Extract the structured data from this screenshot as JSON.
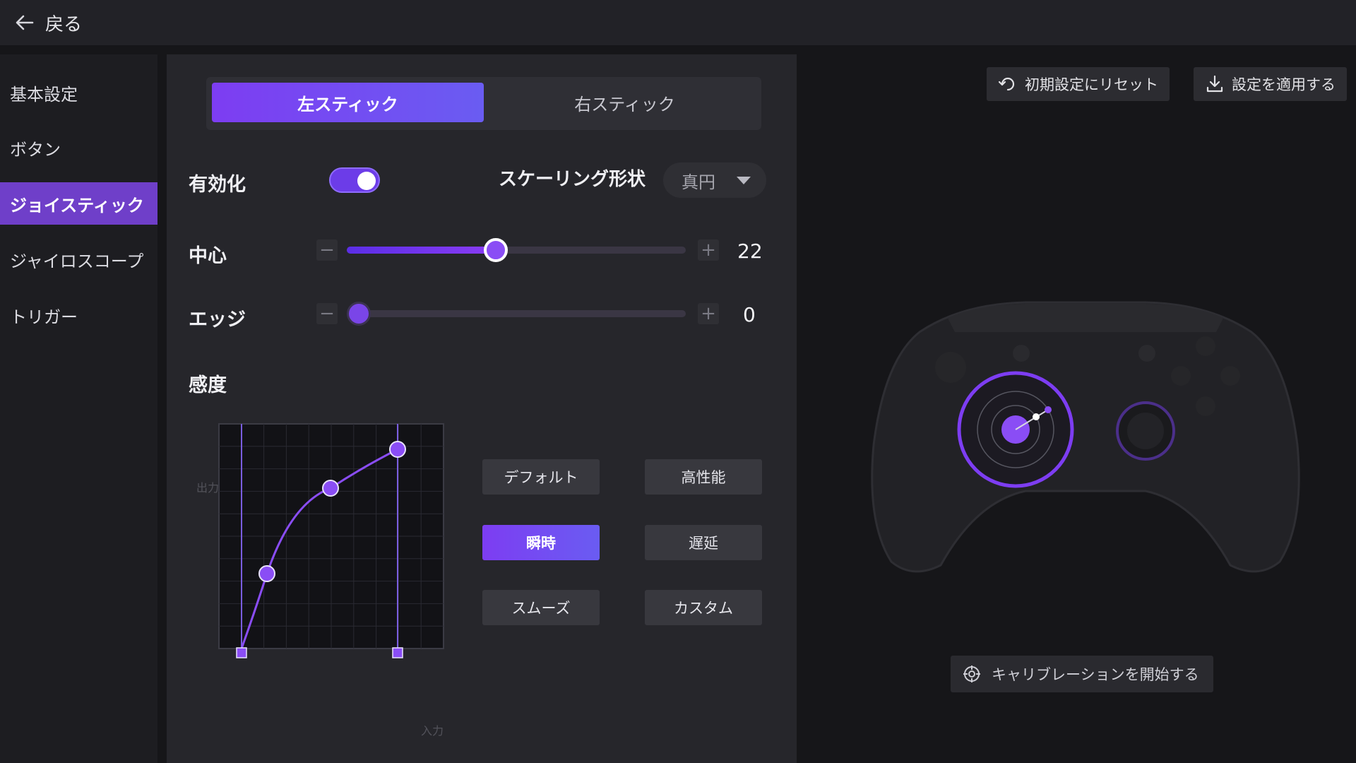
{
  "topbar": {
    "back_label": "戻る"
  },
  "sidebar": {
    "items": [
      {
        "label": "基本設定"
      },
      {
        "label": "ボタン"
      },
      {
        "label": "ジョイスティック"
      },
      {
        "label": "ジャイロスコープ"
      },
      {
        "label": "トリガー"
      }
    ],
    "active_index": 2
  },
  "panel": {
    "tabs": [
      {
        "label": "左スティック",
        "active": true
      },
      {
        "label": "右スティック",
        "active": false
      }
    ],
    "enable": {
      "label": "有効化",
      "value": true
    },
    "scaling": {
      "label": "スケーリング形状",
      "selected": "真円"
    },
    "center": {
      "label": "中心",
      "value": "22",
      "fraction": 0.44
    },
    "edge": {
      "label": "エッジ",
      "value": "0",
      "fraction": 0.0
    },
    "sensitivity": {
      "label": "感度",
      "axis_y": "出力",
      "axis_x": "入力",
      "presets": [
        {
          "label": "デフォルト",
          "active": false
        },
        {
          "label": "高性能",
          "active": false
        },
        {
          "label": "瞬時",
          "active": true
        },
        {
          "label": "遅延",
          "active": false
        },
        {
          "label": "スムーズ",
          "active": false
        },
        {
          "label": "カスタム",
          "active": false
        }
      ]
    }
  },
  "actions": {
    "reset_label": "初期設定にリセット",
    "apply_label": "設定を適用する",
    "calibrate_label": "キャリブレーションを開始する"
  },
  "colors": {
    "accent": "#7d3df2",
    "accent_light": "#8a4df5",
    "background": "#161619",
    "panel": "#26262b"
  },
  "icons": [
    "back-arrow-icon",
    "minus-icon",
    "plus-icon",
    "reset-icon",
    "download-icon",
    "calibration-icon",
    "chevron-down-icon"
  ]
}
